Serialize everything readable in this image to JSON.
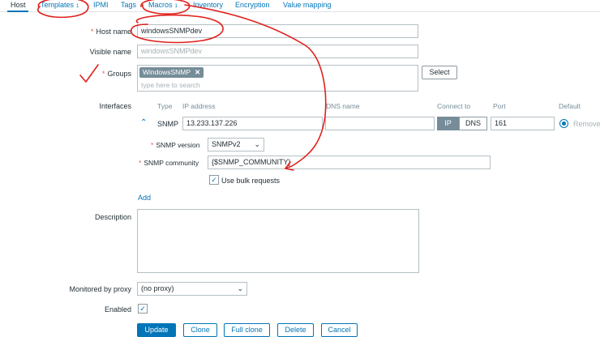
{
  "tabs": [
    {
      "label": "Host"
    },
    {
      "label": "Templates",
      "count": "1"
    },
    {
      "label": "IPMI"
    },
    {
      "label": "Tags"
    },
    {
      "label": "Macros",
      "count": "1"
    },
    {
      "label": "Inventory"
    },
    {
      "label": "Encryption"
    },
    {
      "label": "Value mapping"
    }
  ],
  "form": {
    "host_name": {
      "label": "Host name",
      "value": "windowsSNMPdev"
    },
    "visible_name": {
      "label": "Visible name",
      "placeholder": "windowsSNMPdev"
    },
    "groups": {
      "label": "Groups",
      "chip": "WindowsSNMP",
      "placeholder": "type here to search",
      "select_button": "Select"
    },
    "interfaces": {
      "label": "Interfaces",
      "columns": {
        "type": "Type",
        "ip": "IP address",
        "dns": "DNS name",
        "connect": "Connect to",
        "port": "Port",
        "default": "Default"
      },
      "row": {
        "type": "SNMP",
        "ip": "13.233.137.226",
        "dns": "",
        "connect_ip": "IP",
        "connect_dns": "DNS",
        "port": "161",
        "remove": "Remove"
      },
      "snmp_version": {
        "label": "SNMP version",
        "value": "SNMPv2"
      },
      "snmp_community": {
        "label": "SNMP community",
        "value": "{$SNMP_COMMUNITY}"
      },
      "bulk": {
        "label": "Use bulk requests",
        "checked": true
      },
      "add_link": "Add"
    },
    "description": {
      "label": "Description",
      "value": ""
    },
    "proxy": {
      "label": "Monitored by proxy",
      "value": "(no proxy)"
    },
    "enabled": {
      "label": "Enabled",
      "checked": true
    }
  },
  "buttons": {
    "update": "Update",
    "clone": "Clone",
    "full_clone": "Full clone",
    "delete": "Delete",
    "cancel": "Cancel"
  },
  "colors": {
    "accent": "#0275b8",
    "required": "#e45959",
    "annotation": "#e0201b"
  }
}
